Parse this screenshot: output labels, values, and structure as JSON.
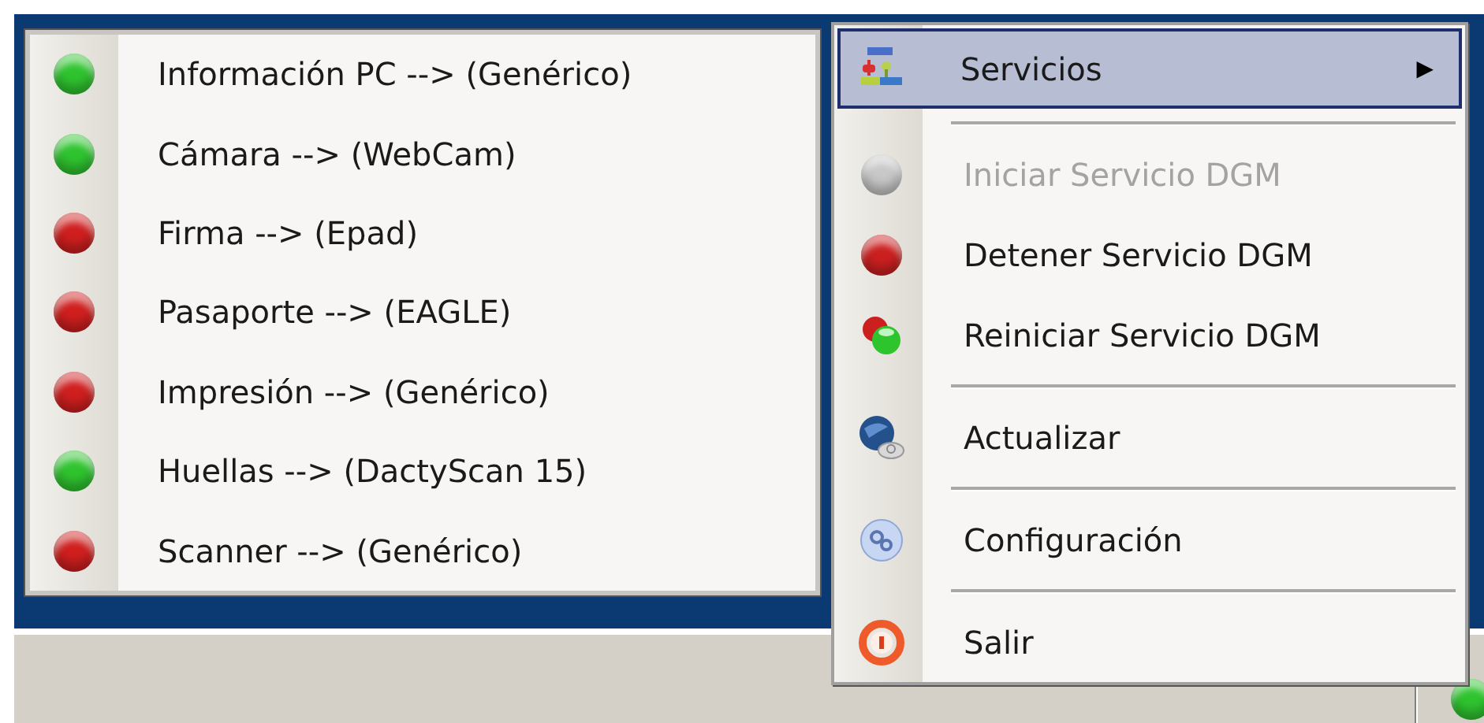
{
  "devices": [
    {
      "label": "Información PC --> (Genérico)",
      "color": "#2fc42f"
    },
    {
      "label": "Cámara --> (WebCam)",
      "color": "#2fc42f"
    },
    {
      "label": "Firma --> (Epad)",
      "color": "#d01f1f"
    },
    {
      "label": "Pasaporte --> (EAGLE)",
      "color": "#d01f1f"
    },
    {
      "label": "Impresión --> (Genérico)",
      "color": "#d01f1f"
    },
    {
      "label": "Huellas --> (DactyScan 15)",
      "color": "#2fc42f"
    },
    {
      "label": "Scanner --> (Genérico)",
      "color": "#d01f1f"
    }
  ],
  "context_menu": [
    {
      "kind": "submenu",
      "label": "Servicios",
      "submenu_arrow": "▶",
      "selected": true,
      "disabled": false
    },
    {
      "kind": "separator"
    },
    {
      "kind": "item",
      "label": "Iniciar Servicio DGM",
      "selected": false,
      "disabled": true
    },
    {
      "kind": "item",
      "label": "Detener Servicio DGM",
      "selected": false,
      "disabled": false
    },
    {
      "kind": "item",
      "label": "Reiniciar Servicio DGM",
      "selected": false,
      "disabled": false
    },
    {
      "kind": "separator"
    },
    {
      "kind": "item",
      "label": "Actualizar",
      "selected": false,
      "disabled": false
    },
    {
      "kind": "separator"
    },
    {
      "kind": "item",
      "label": "Configuración",
      "selected": false,
      "disabled": false
    },
    {
      "kind": "separator"
    },
    {
      "kind": "item",
      "label": "Salir",
      "selected": false,
      "disabled": false
    }
  ]
}
